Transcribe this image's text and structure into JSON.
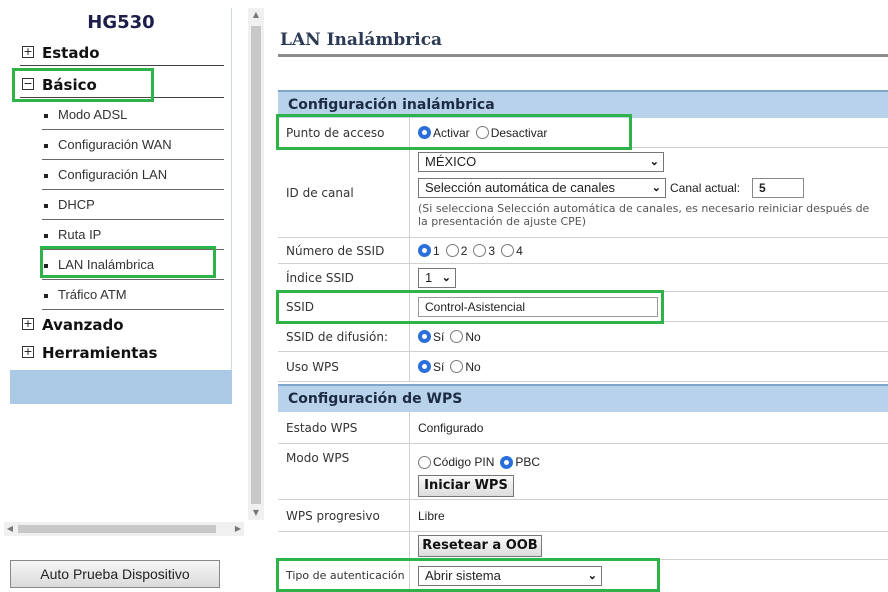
{
  "nav": {
    "model": "HG530",
    "sections": [
      {
        "label": "Estado",
        "box": "+"
      },
      {
        "label": "Básico",
        "box": "−"
      },
      {
        "label": "Avanzado",
        "box": "+"
      },
      {
        "label": "Herramientas",
        "box": "+"
      }
    ],
    "basic_items": [
      "Modo ADSL",
      "Configuración WAN",
      "Configuración LAN",
      "DHCP",
      "Ruta IP",
      "LAN Inalámbrica",
      "Tráfico ATM"
    ]
  },
  "auto_test_button": "Auto Prueba Dispositivo",
  "page_title": "LAN Inalámbrica",
  "wireless": {
    "header": "Configuración inalámbrica",
    "access_point": {
      "label": "Punto de acceso",
      "on": "Activar",
      "off": "Desactivar",
      "selected": "Activar"
    },
    "country": "MÉXICO",
    "channel": {
      "label": "ID de canal",
      "selected": "Selección automática de canales",
      "current_label": "Canal actual:",
      "current_value": "5",
      "note": "(Si selecciona Selección automática de canales, es necesario reiniciar después de la presentación de ajuste CPE)"
    },
    "ssid_count": {
      "label": "Número de SSID",
      "options": [
        "1",
        "2",
        "3",
        "4"
      ],
      "selected": "1"
    },
    "ssid_index": {
      "label": "Índice SSID",
      "value": "1"
    },
    "ssid": {
      "label": "SSID",
      "value": "Control-Asistencial"
    },
    "broadcast": {
      "label": "SSID de difusión:",
      "yes": "Sí",
      "no": "No",
      "selected": "Sí"
    },
    "wps_use": {
      "label": "Uso WPS",
      "yes": "Sí",
      "no": "No",
      "selected": "Sí"
    }
  },
  "wps": {
    "header": "Configuración de WPS",
    "state": {
      "label": "Estado WPS",
      "value": "Configurado"
    },
    "mode": {
      "label": "Modo WPS",
      "pin": "Código PIN",
      "pbc": "PBC",
      "selected": "PBC"
    },
    "start_button": "Iniciar WPS",
    "progress": {
      "label": "WPS progresivo",
      "value": "Libre"
    },
    "reset_button": "Resetear a OOB",
    "auth": {
      "label": "Tipo de autenticación",
      "value": "Abrir sistema"
    }
  },
  "colors": {
    "highlight": "#2db34a",
    "header_bg": "#b7d2ea",
    "nav_bg": "#a9c9e4",
    "radio_on": "#2a6fdb"
  }
}
